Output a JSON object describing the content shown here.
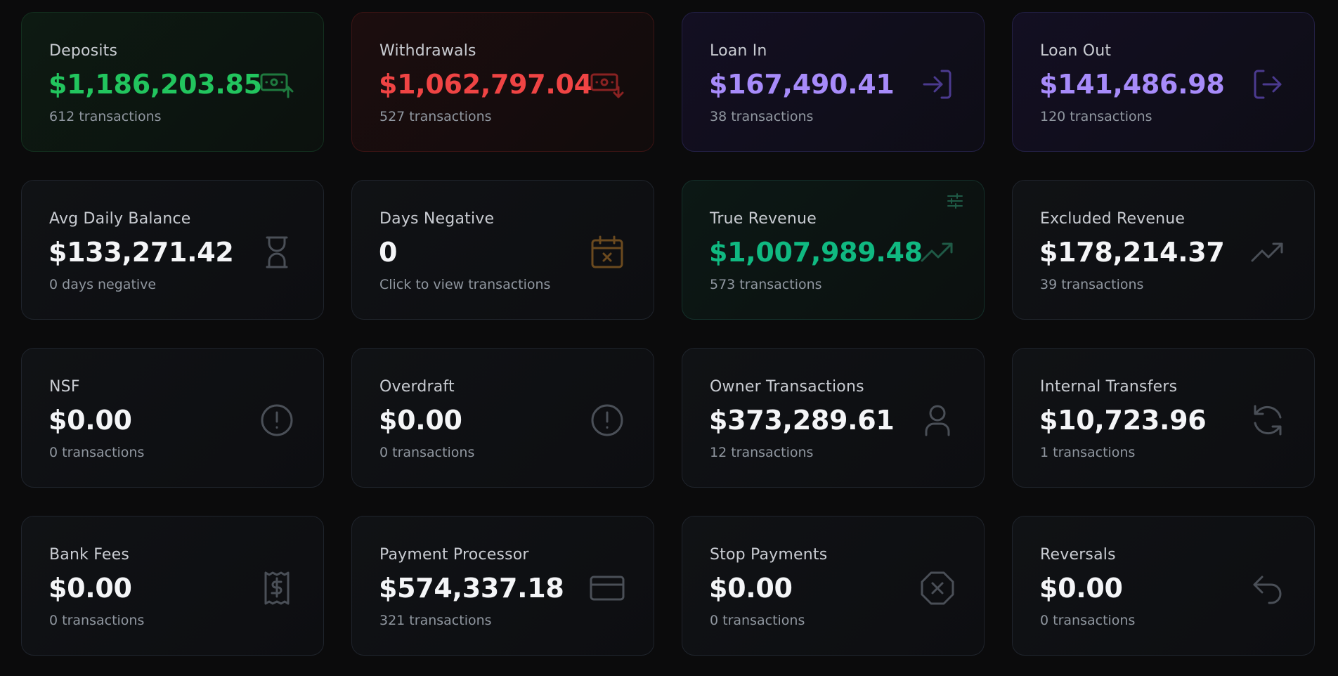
{
  "colors": {
    "green": "#22c55e",
    "red": "#ef4444",
    "purple": "#a78bfa",
    "teal": "#10b981",
    "white": "#f4f5f7",
    "muted_icon": "#4a4f57"
  },
  "cards": [
    {
      "label": "Deposits",
      "value": "$1,186,203.85",
      "sub": "612 transactions",
      "icon": "cash-deposit-icon",
      "accent": "#22c55e"
    },
    {
      "label": "Withdrawals",
      "value": "$1,062,797.04",
      "sub": "527 transactions",
      "icon": "cash-withdraw-icon",
      "accent": "#ef4444"
    },
    {
      "label": "Loan In",
      "value": "$167,490.41",
      "sub": "38 transactions",
      "icon": "login-arrow-icon",
      "accent": "#a78bfa"
    },
    {
      "label": "Loan Out",
      "value": "$141,486.98",
      "sub": "120 transactions",
      "icon": "logout-arrow-icon",
      "accent": "#a78bfa"
    },
    {
      "label": "Avg Daily Balance",
      "value": "$133,271.42",
      "sub": "0 days negative",
      "icon": "hourglass-icon"
    },
    {
      "label": "Days Negative",
      "value": "0",
      "sub": "Click to view transactions",
      "icon": "calendar-x-icon"
    },
    {
      "label": "True Revenue",
      "value": "$1,007,989.48",
      "sub": "573 transactions",
      "icon": "trending-up-icon",
      "corner_icon": "sliders-icon",
      "accent": "#10b981"
    },
    {
      "label": "Excluded Revenue",
      "value": "$178,214.37",
      "sub": "39 transactions",
      "icon": "trending-up-icon"
    },
    {
      "label": "NSF",
      "value": "$0.00",
      "sub": "0 transactions",
      "icon": "alert-circle-icon"
    },
    {
      "label": "Overdraft",
      "value": "$0.00",
      "sub": "0 transactions",
      "icon": "alert-circle-icon"
    },
    {
      "label": "Owner Transactions",
      "value": "$373,289.61",
      "sub": "12 transactions",
      "icon": "user-icon"
    },
    {
      "label": "Internal Transfers",
      "value": "$10,723.96",
      "sub": "1 transactions",
      "icon": "refresh-icon"
    },
    {
      "label": "Bank Fees",
      "value": "$0.00",
      "sub": "0 transactions",
      "icon": "receipt-dollar-icon"
    },
    {
      "label": "Payment Processor",
      "value": "$574,337.18",
      "sub": "321 transactions",
      "icon": "credit-card-icon"
    },
    {
      "label": "Stop Payments",
      "value": "$0.00",
      "sub": "0 transactions",
      "icon": "octagon-x-icon"
    },
    {
      "label": "Reversals",
      "value": "$0.00",
      "sub": "0 transactions",
      "icon": "undo-arrow-icon"
    }
  ]
}
